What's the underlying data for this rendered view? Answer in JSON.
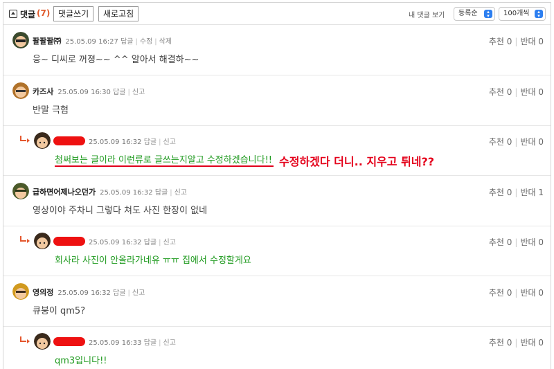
{
  "toolbar": {
    "title": "댓글",
    "count": "(7)",
    "write_button": "댓글쓰기",
    "refresh_button": "새로고침",
    "my_comments": "내 댓글 보기",
    "sort_select": "등록순",
    "page_size_select": "100개씩"
  },
  "comments": [
    {
      "nick": "팔팔팔㈜",
      "date": "25.05.09 16:27",
      "actions": [
        "답글",
        "수정",
        "삭제"
      ],
      "text": "응~ 디씨로 꺼졍~~ ^^ 알아서 해결하~~",
      "votes": {
        "up": "추천 0",
        "down": "반대 0"
      }
    },
    {
      "nick": "카즈사",
      "date": "25.05.09 16:30",
      "actions": [
        "답글",
        "신고"
      ],
      "text": "반말 극혐",
      "votes": {
        "up": "추천 0",
        "down": "반대 0"
      }
    },
    {
      "nick": "",
      "date": "25.05.09 16:32",
      "actions": [
        "답글",
        "신고"
      ],
      "text": "첨써보는 글이라 이런류로 글쓰는지알고 수정하겠습니다!!",
      "votes": {
        "up": "추천 0",
        "down": "반대 0"
      }
    },
    {
      "nick": "급하면어제나오던가",
      "date": "25.05.09 16:32",
      "actions": [
        "답글",
        "신고"
      ],
      "text": "영상이야 주차니 그렇다 쳐도 사진 한장이 없네",
      "votes": {
        "up": "추천 0",
        "down": "반대 1"
      }
    },
    {
      "nick": "",
      "date": "25.05.09 16:32",
      "actions": [
        "답글",
        "신고"
      ],
      "text": "회사라 사진이 안올라가네유 ㅠㅠ 집에서 수정할게요",
      "votes": {
        "up": "추천 0",
        "down": "반대 0"
      }
    },
    {
      "nick": "영의정",
      "date": "25.05.09 16:32",
      "actions": [
        "답글",
        "신고"
      ],
      "text": "큐붕이 qm5?",
      "votes": {
        "up": "추천 0",
        "down": "반대 0"
      }
    },
    {
      "nick": "",
      "date": "25.05.09 16:33",
      "actions": [
        "답글",
        "신고"
      ],
      "text": "qm3입니다!!",
      "votes": {
        "up": "추천 0",
        "down": "반대 0"
      }
    }
  ],
  "annotation": "수정하겠다 더니.. 지우고 튀네??",
  "colors": {
    "accent": "#e05a2b",
    "reply_text": "#1f9a1f",
    "redaction": "#e11111",
    "annotation": "#e4001a",
    "select_arrow": "#2d7ff0"
  }
}
